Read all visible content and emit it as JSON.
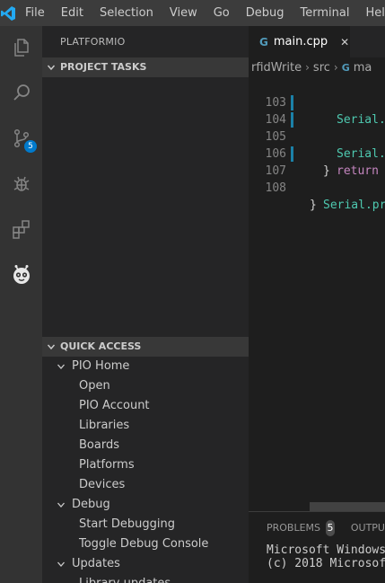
{
  "menubar": {
    "items": [
      "File",
      "Edit",
      "Selection",
      "View",
      "Go",
      "Debug",
      "Terminal",
      "Help"
    ]
  },
  "activitybar": {
    "icons": [
      "explorer-icon",
      "search-icon",
      "source-control-icon",
      "debug-icon",
      "extensions-icon",
      "platformio-icon"
    ],
    "scm_badge": "5"
  },
  "sidebar": {
    "title": "PLATFORMIO",
    "project_tasks": "PROJECT TASKS",
    "quick_access": "QUICK ACCESS",
    "groups": [
      {
        "label": "PIO Home",
        "items": [
          "Open",
          "PIO Account",
          "Libraries",
          "Boards",
          "Platforms",
          "Devices"
        ]
      },
      {
        "label": "Debug",
        "items": [
          "Start Debugging",
          "Toggle Debug Console"
        ]
      },
      {
        "label": "Updates",
        "items": [
          "Library updates"
        ]
      }
    ]
  },
  "editor": {
    "tab_label": "main.cpp",
    "tab_icon": "G",
    "breadcrumbs": [
      "rfidWrite",
      "src",
      "ma"
    ],
    "lines": [
      {
        "num": "103",
        "code": "Serial."
      },
      {
        "num": "104",
        "code": "Serial."
      },
      {
        "num": "105",
        "code": "return"
      },
      {
        "num": "106",
        "code": "}"
      },
      {
        "num": "107",
        "code": "Serial.pr"
      },
      {
        "num": "108",
        "code": "}"
      }
    ]
  },
  "panel": {
    "problems_label": "PROBLEMS",
    "problems_count": "5",
    "output_label": "OUTPU",
    "terminal_lines": [
      "Microsoft Windows",
      "(c) 2018 Microsof"
    ]
  },
  "colors": {
    "accent": "#007acc",
    "activitybar_bg": "#333333",
    "sidebar_bg": "#252526",
    "editor_bg": "#1e1e1e"
  }
}
